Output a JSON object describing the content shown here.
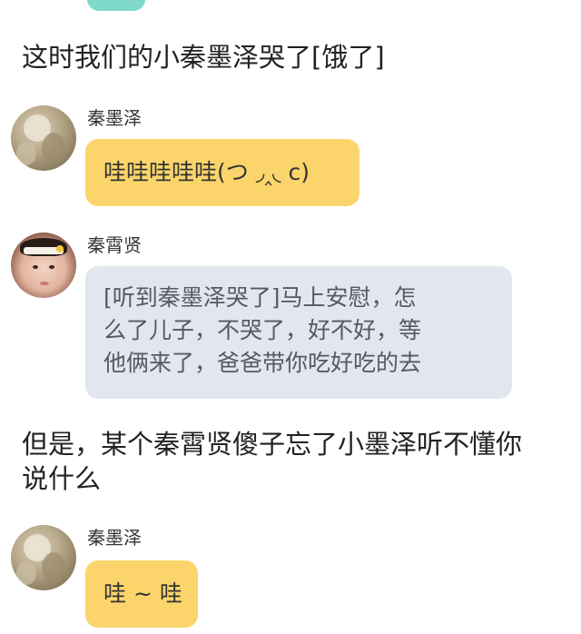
{
  "colors": {
    "yellow_bubble": "#fbd56b",
    "gray_bubble": "#e2e7ef",
    "top_bubble": "#7fd9cc"
  },
  "narration_1": "这时我们的小秦墨泽哭了[饿了]",
  "msg_1": {
    "sender": "秦墨泽",
    "text": "哇哇哇哇哇(つ ◞‸◟ c)"
  },
  "msg_2": {
    "sender": "秦霄贤",
    "lines": [
      "[听到秦墨泽哭了]马上安慰，怎",
      "么了儿子，不哭了，好不好，等",
      "他俩来了，爸爸带你吃好吃的去"
    ]
  },
  "narration_2": {
    "lines": [
      "但是，某个秦霄贤傻子忘了小墨泽听不懂你",
      "说什么"
    ]
  },
  "msg_3": {
    "sender": "秦墨泽",
    "text": "哇 ~ 哇"
  }
}
